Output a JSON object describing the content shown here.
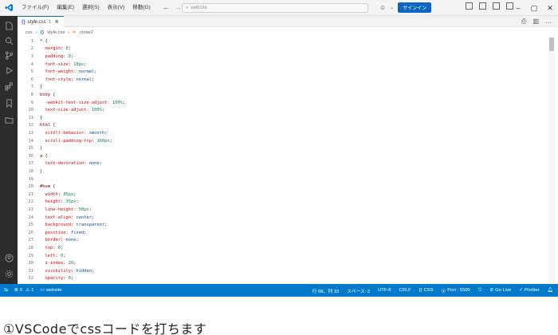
{
  "titlebar": {
    "menu": [
      "ファイル(F)",
      "編集(E)",
      "選択(S)",
      "表示(V)",
      "移動(G)"
    ],
    "search_placeholder": "website",
    "signin_label": "サインイン"
  },
  "tab": {
    "label": "style.css",
    "count": "1"
  },
  "breadcrumb": [
    "css",
    "style.css",
    ".close2"
  ],
  "editor": {
    "lines": [
      {
        "n": "1",
        "t": [
          [
            "sel",
            "* "
          ],
          [
            "punc",
            "{"
          ]
        ]
      },
      {
        "n": "2",
        "t": [
          [
            "ws",
            "··"
          ],
          [
            "prop",
            "margin"
          ],
          [
            "punc",
            ": "
          ],
          [
            "num",
            "0"
          ],
          [
            "punc",
            ";"
          ]
        ]
      },
      {
        "n": "3",
        "t": [
          [
            "ws",
            "··"
          ],
          [
            "prop",
            "padding"
          ],
          [
            "punc",
            ": "
          ],
          [
            "num",
            "0"
          ],
          [
            "punc",
            ";"
          ]
        ]
      },
      {
        "n": "4",
        "t": [
          [
            "ws",
            "··"
          ],
          [
            "prop",
            "font-size"
          ],
          [
            "punc",
            ": "
          ],
          [
            "num",
            "18px"
          ],
          [
            "punc",
            ";"
          ]
        ]
      },
      {
        "n": "5",
        "t": [
          [
            "ws",
            "··"
          ],
          [
            "prop",
            "font-weight"
          ],
          [
            "punc",
            ": "
          ],
          [
            "val",
            "normal"
          ],
          [
            "punc",
            ";"
          ]
        ]
      },
      {
        "n": "6",
        "t": [
          [
            "ws",
            "··"
          ],
          [
            "prop",
            "font-style"
          ],
          [
            "punc",
            ": "
          ],
          [
            "val",
            "normal"
          ],
          [
            "punc",
            ";"
          ]
        ]
      },
      {
        "n": "7",
        "t": [
          [
            "punc",
            "}"
          ]
        ]
      },
      {
        "n": "8",
        "t": [
          [
            "sel",
            "body "
          ],
          [
            "punc",
            "{"
          ]
        ]
      },
      {
        "n": "9",
        "t": [
          [
            "ws",
            "··"
          ],
          [
            "prop",
            "-webkit-text-size-adjust"
          ],
          [
            "punc",
            ": "
          ],
          [
            "num",
            "100%"
          ],
          [
            "punc",
            ";"
          ]
        ]
      },
      {
        "n": "10",
        "t": [
          [
            "ws",
            "··"
          ],
          [
            "prop",
            "text-size-adjust"
          ],
          [
            "punc",
            ": "
          ],
          [
            "num",
            "100%"
          ],
          [
            "punc",
            ";"
          ]
        ]
      },
      {
        "n": "11",
        "t": [
          [
            "punc",
            "}"
          ]
        ]
      },
      {
        "n": "12",
        "t": [
          [
            "sel",
            "html "
          ],
          [
            "punc",
            "{"
          ]
        ]
      },
      {
        "n": "13",
        "t": [
          [
            "ws",
            "··"
          ],
          [
            "prop",
            "scroll-behavior"
          ],
          [
            "punc",
            ": "
          ],
          [
            "val",
            "smooth"
          ],
          [
            "punc",
            ";"
          ]
        ]
      },
      {
        "n": "14",
        "t": [
          [
            "ws",
            "··"
          ],
          [
            "prop",
            "scroll-padding-top"
          ],
          [
            "punc",
            ": "
          ],
          [
            "num",
            "160px"
          ],
          [
            "punc",
            ";"
          ]
        ]
      },
      {
        "n": "15",
        "t": [
          [
            "punc",
            "}"
          ]
        ]
      },
      {
        "n": "16",
        "t": [
          [
            "sel",
            "a "
          ],
          [
            "punc",
            "{"
          ]
        ]
      },
      {
        "n": "17",
        "t": [
          [
            "ws",
            "··"
          ],
          [
            "prop",
            "text-decoration"
          ],
          [
            "punc",
            ": "
          ],
          [
            "val",
            "none"
          ],
          [
            "punc",
            ";"
          ]
        ]
      },
      {
        "n": "18",
        "t": [
          [
            "punc",
            "}"
          ]
        ]
      },
      {
        "n": "19",
        "t": []
      },
      {
        "n": "20",
        "t": [
          [
            "sel",
            "#hum "
          ],
          [
            "punc",
            "{"
          ]
        ]
      },
      {
        "n": "21",
        "t": [
          [
            "ws",
            "··"
          ],
          [
            "prop",
            "width"
          ],
          [
            "punc",
            ": "
          ],
          [
            "num",
            "35px"
          ],
          [
            "punc",
            ";"
          ]
        ]
      },
      {
        "n": "22",
        "t": [
          [
            "ws",
            "··"
          ],
          [
            "prop",
            "height"
          ],
          [
            "punc",
            ": "
          ],
          [
            "num",
            "35px"
          ],
          [
            "punc",
            ";"
          ]
        ]
      },
      {
        "n": "23",
        "t": [
          [
            "ws",
            "··"
          ],
          [
            "prop",
            "line-height"
          ],
          [
            "punc",
            ": "
          ],
          [
            "num",
            "50px"
          ],
          [
            "punc",
            ";"
          ]
        ]
      },
      {
        "n": "24",
        "t": [
          [
            "ws",
            "··"
          ],
          [
            "prop",
            "text-align"
          ],
          [
            "punc",
            ": "
          ],
          [
            "val",
            "center"
          ],
          [
            "punc",
            ";"
          ]
        ]
      },
      {
        "n": "25",
        "t": [
          [
            "ws",
            "··"
          ],
          [
            "prop",
            "background"
          ],
          [
            "punc",
            ": "
          ],
          [
            "val",
            "transparent"
          ],
          [
            "punc",
            ";"
          ]
        ]
      },
      {
        "n": "26",
        "t": [
          [
            "ws",
            "··"
          ],
          [
            "prop",
            "position"
          ],
          [
            "punc",
            ": "
          ],
          [
            "val",
            "fixed"
          ],
          [
            "punc",
            ";"
          ]
        ]
      },
      {
        "n": "27",
        "t": [
          [
            "ws",
            "··"
          ],
          [
            "prop",
            "border"
          ],
          [
            "punc",
            ": "
          ],
          [
            "val",
            "none"
          ],
          [
            "punc",
            ";"
          ]
        ]
      },
      {
        "n": "28",
        "t": [
          [
            "ws",
            "··"
          ],
          [
            "prop",
            "top"
          ],
          [
            "punc",
            ": "
          ],
          [
            "num",
            "0"
          ],
          [
            "punc",
            ";"
          ]
        ]
      },
      {
        "n": "29",
        "t": [
          [
            "ws",
            "··"
          ],
          [
            "prop",
            "left"
          ],
          [
            "punc",
            ": "
          ],
          [
            "num",
            "0"
          ],
          [
            "punc",
            ";"
          ]
        ]
      },
      {
        "n": "30",
        "t": [
          [
            "ws",
            "··"
          ],
          [
            "prop",
            "z-index"
          ],
          [
            "punc",
            ": "
          ],
          [
            "num",
            "20"
          ],
          [
            "punc",
            ";"
          ]
        ]
      },
      {
        "n": "31",
        "t": [
          [
            "ws",
            "··"
          ],
          [
            "prop",
            "visibility"
          ],
          [
            "punc",
            ": "
          ],
          [
            "val",
            "hidden"
          ],
          [
            "punc",
            ";"
          ]
        ]
      },
      {
        "n": "32",
        "t": [
          [
            "ws",
            "··"
          ],
          [
            "prop",
            "opacity"
          ],
          [
            "punc",
            ": "
          ],
          [
            "num",
            "0"
          ],
          [
            "punc",
            ";"
          ]
        ]
      }
    ]
  },
  "statusbar": {
    "errors": "0",
    "warnings": "1",
    "folder": "website",
    "position": "行 68、列 33",
    "spaces": "スペース: 2",
    "encoding": "UTF-8",
    "eol": "CRLF",
    "language": "CSS",
    "port": "Port : 5500",
    "golive": "Go Live",
    "prettier": "Prettier"
  },
  "caption": "①VSCodeでcssコードを打ちます",
  "colors": {
    "accent": "#007acc",
    "activity_bar": "#2c2c2c",
    "signin": "#0a66c2"
  }
}
